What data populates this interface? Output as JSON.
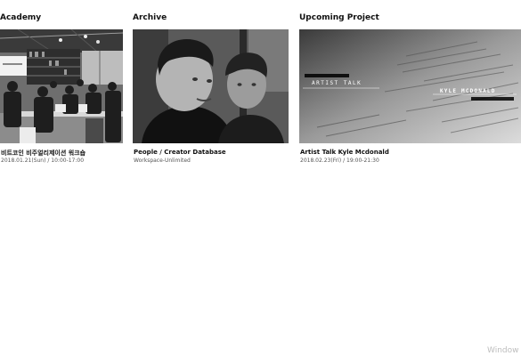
{
  "sections": {
    "academy": {
      "title": "Academy",
      "card": {
        "title": "비트코인 비주얼리제이션 워크숍",
        "subtitle": "2018.01.21(Sun)  /  10:00-17:00",
        "image": "workshop-classroom-photo"
      }
    },
    "archive": {
      "title": "Archive",
      "card": {
        "title": "People / Creator Database",
        "subtitle": "Workspace-Unlimited",
        "image": "two-people-portrait-photo"
      }
    },
    "upcoming": {
      "title": "Upcoming Project",
      "card": {
        "title": "Artist Talk Kyle Mcdonald",
        "subtitle": "2018.02.23(Fri)  /  19:00-21:30",
        "image": "code-screen-poster",
        "overlay": {
          "event_label": "ARTIST TALK",
          "speaker": "KYLE MCDONALD"
        }
      }
    }
  },
  "watermark": "Window"
}
